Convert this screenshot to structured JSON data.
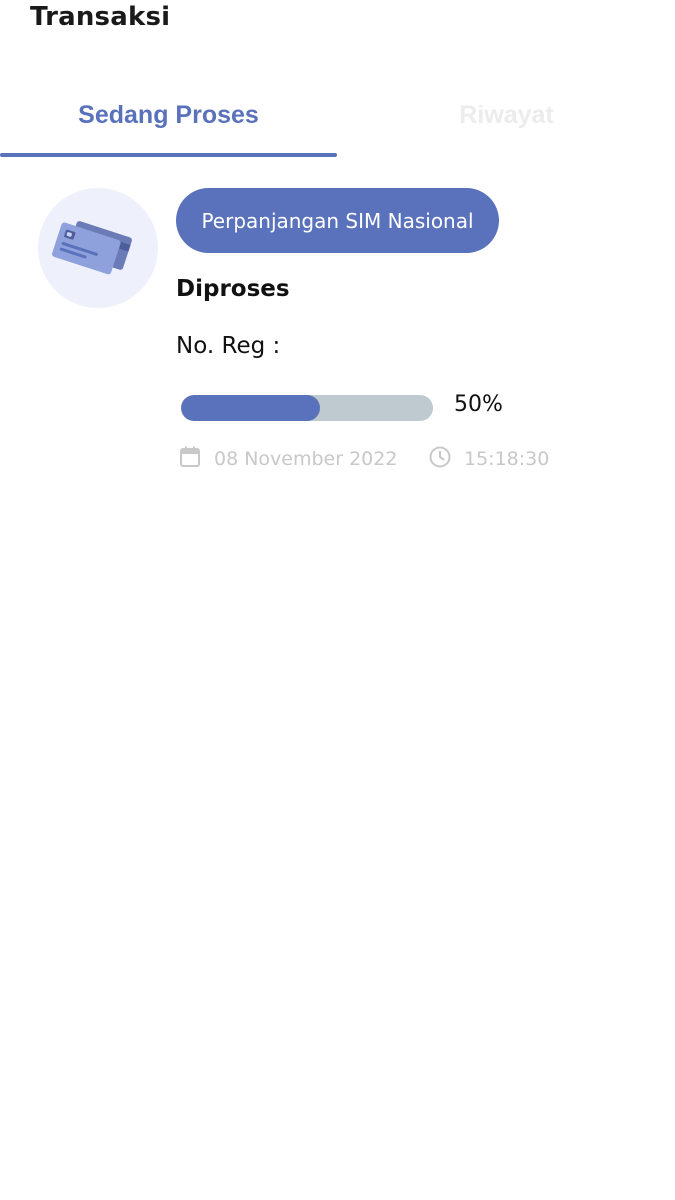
{
  "header": {
    "title": "Transaksi"
  },
  "tabs": [
    {
      "label": "Sedang Proses",
      "active": true
    },
    {
      "label": "Riwayat",
      "active": false
    }
  ],
  "transaction": {
    "icon": "credit-card-icon",
    "service_label": "Perpanjangan SIM Nasional",
    "status": "Diproses",
    "reg_label": "No. Reg :",
    "reg_value": "",
    "progress_fraction": 0.5,
    "progress_text": "50%",
    "date_icon": "calendar-icon",
    "date": "08 November 2022",
    "time_icon": "clock-icon",
    "time": "15:18:30"
  },
  "colors": {
    "accent": "#5a72bb",
    "progress_track": "#bfc9d0",
    "muted_text": "#c8c8c8",
    "inactive_tab": "#ececec"
  }
}
